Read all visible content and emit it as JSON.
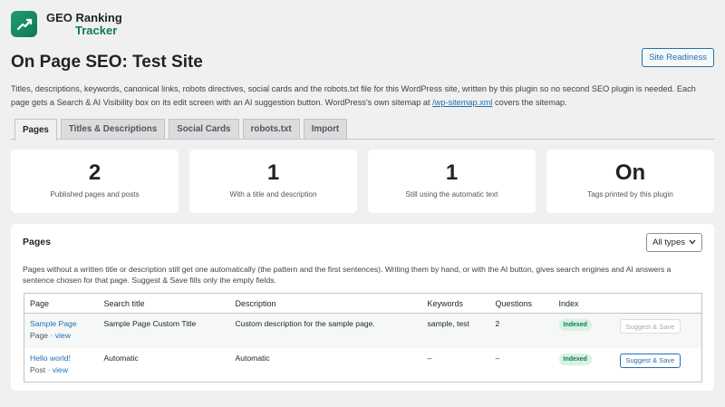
{
  "brand": {
    "line1": "GEO Ranking",
    "line2": "Tracker"
  },
  "header": {
    "title": "On Page SEO: Test Site",
    "readiness_button": "Site Readiness"
  },
  "intro": {
    "text_before": "Titles, descriptions, keywords, canonical links, robots directives, social cards and the robots.txt file for this WordPress site, written by this plugin so no second SEO plugin is needed. Each page gets a Search & AI Visibility box on its edit screen with an AI suggestion button. WordPress's own sitemap at ",
    "link": "/wp-sitemap.xml",
    "text_after": " covers the sitemap."
  },
  "tabs": [
    "Pages",
    "Titles & Descriptions",
    "Social Cards",
    "robots.txt",
    "Import"
  ],
  "active_tab": "Pages",
  "stats": [
    {
      "value": "2",
      "label": "Published pages and posts"
    },
    {
      "value": "1",
      "label": "With a title and description"
    },
    {
      "value": "1",
      "label": "Still using the automatic text"
    },
    {
      "value": "On",
      "label": "Tags printed by this plugin"
    }
  ],
  "panel": {
    "title": "Pages",
    "filter": "All types",
    "description": "Pages without a written title or description still get one automatically (the pattern and the first sentences). Writing them by hand, or with the AI button, gives search engines and AI answers a sentence chosen for that page. Suggest & Save fills only the empty fields."
  },
  "table": {
    "headers": [
      "Page",
      "Search title",
      "Description",
      "Keywords",
      "Questions",
      "Index",
      ""
    ],
    "rows": [
      {
        "page": "Sample Page",
        "type": "Page",
        "sep": " · ",
        "view": "view",
        "search_title": "Sample Page Custom Title",
        "description": "Custom description for the sample page.",
        "keywords": "sample, test",
        "questions": "2",
        "index": "Indexed",
        "action": "Suggest & Save",
        "action_disabled": true
      },
      {
        "page": "Hello world!",
        "type": "Post",
        "sep": " · ",
        "view": "view",
        "search_title": "Automatic",
        "description": "Automatic",
        "keywords": "–",
        "questions": "–",
        "index": "Indexed",
        "action": "Suggest & Save",
        "action_disabled": false
      }
    ]
  },
  "colors": {
    "accent": "#2271b1",
    "brand": "#0f7a57",
    "indexed_bg": "#d7f2e2"
  }
}
